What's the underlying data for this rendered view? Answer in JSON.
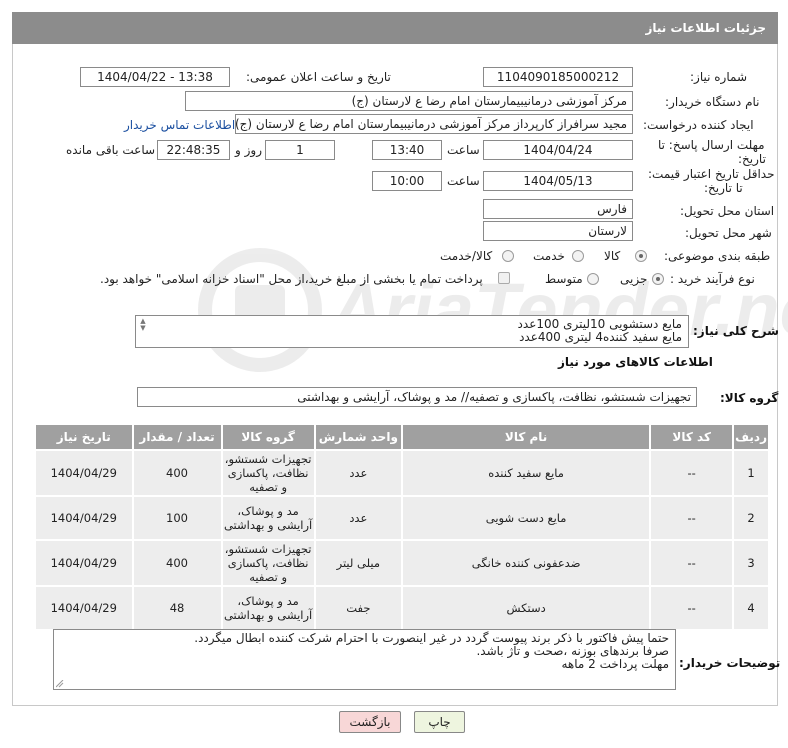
{
  "header": {
    "title": "جزئیات اطلاعات نیاز"
  },
  "form": {
    "need_number_label": "شماره نیاز:",
    "need_number": "1104090185000212",
    "announce_label": "تاریخ و ساعت اعلان عمومی:",
    "announce_value": "1404/04/22 - 13:38",
    "buyer_label": "نام دستگاه خریدار:",
    "buyer_value": "مرکز آموزشی درمانیبیمارستان امام رضا  ع  لارستان (ج)",
    "creator_label": "ایجاد کننده درخواست:",
    "creator_value": "مجید سرافراز کارپرداز  مرکز آموزشی درمانیبیمارستان امام رضا  ع  لارستان (ج)",
    "contact_link": "اطلاعات تماس خریدار",
    "deadline_label_1": "مهلت ارسال پاسخ: تا",
    "deadline_label_2": "تاریخ:",
    "deadline_date": "1404/04/24",
    "time_label": "ساعت",
    "deadline_time": "13:40",
    "days_value": "1",
    "days_label": "روز و",
    "remaining_time": "22:48:35",
    "remaining_label": "ساعت باقی مانده",
    "min_price_label_1": "حداقل تاریخ اعتبار قیمت:",
    "min_price_label_2": "تا تاریخ:",
    "price_date": "1404/05/13",
    "price_time": "10:00",
    "province_label": "استان محل تحویل:",
    "province_value": "فارس",
    "city_label": "شهر محل تحویل:",
    "city_value": "لارستان",
    "category_label": "طبقه بندی موضوعی:",
    "category_options": [
      "کالا",
      "خدمت",
      "کالا/خدمت"
    ],
    "category_selected": "کالا",
    "process_label": "نوع فرآیند خرید :",
    "process_options": [
      "جزیی",
      "متوسط"
    ],
    "process_selected": "جزیی",
    "payment_note": "پرداخت تمام یا بخشی از مبلغ خرید،از محل \"اسناد خزانه اسلامی\" خواهد بود."
  },
  "summary": {
    "label": "شرح کلی نیاز:",
    "lines": [
      "مایع دستشویی 10لیتری        100عدد",
      "مایع سفید کننده4 لیتری         400عدد"
    ]
  },
  "goods": {
    "section_title": "اطلاعات کالاهای مورد نیاز",
    "group_label": "گروه کالا:",
    "group_value": "تجهیزات شستشو، نظافت، پاکسازی و تصفیه// مد و پوشاک، آرایشی و بهداشتی",
    "columns": [
      "ردیف",
      "کد کالا",
      "نام کالا",
      "واحد شمارش",
      "گروه کالا",
      "تعداد / مقدار",
      "تاریخ نیاز"
    ],
    "rows": [
      {
        "idx": "1",
        "code": "--",
        "name": "مایع سفید کننده",
        "unit": "عدد",
        "group": "تجهیزات شستشو، نظافت، پاکسازی و تصفیه",
        "qty": "400",
        "date": "1404/04/29"
      },
      {
        "idx": "2",
        "code": "--",
        "name": "مایع دست شویی",
        "unit": "عدد",
        "group": "مد و پوشاک، آرایشی و بهداشتی",
        "qty": "100",
        "date": "1404/04/29"
      },
      {
        "idx": "3",
        "code": "--",
        "name": "ضدعفونی کننده خانگی",
        "unit": "میلی لیتر",
        "group": "تجهیزات شستشو، نظافت، پاکسازی و تصفیه",
        "qty": "400",
        "date": "1404/04/29"
      },
      {
        "idx": "4",
        "code": "--",
        "name": "دستکش",
        "unit": "جفت",
        "group": "مد و پوشاک، آرایشی و بهداشتی",
        "qty": "48",
        "date": "1404/04/29"
      }
    ]
  },
  "notes": {
    "label": "توضیحات خریدار:",
    "lines": [
      "حتما پیش فاکتور با ذکر برند پیوست گردد در غیر اینصورت با احترام شرکت کننده ابطال میگردد.",
      "صرفا برندهای بوزنه ،صحت و تاژ باشد.",
      "مهلت پرداخت 2 ماهه"
    ]
  },
  "buttons": {
    "print": "چاپ",
    "back": "بازگشت"
  },
  "watermark": {
    "text": "AriaTender.neT"
  },
  "colors": {
    "header_bg": "#8c8c8c",
    "table_header_bg": "#a0a0a0",
    "row_bg": "#ededed",
    "link": "#1b4fa0",
    "back_btn": "#f8d7d7",
    "print_btn": "#eef5df"
  }
}
